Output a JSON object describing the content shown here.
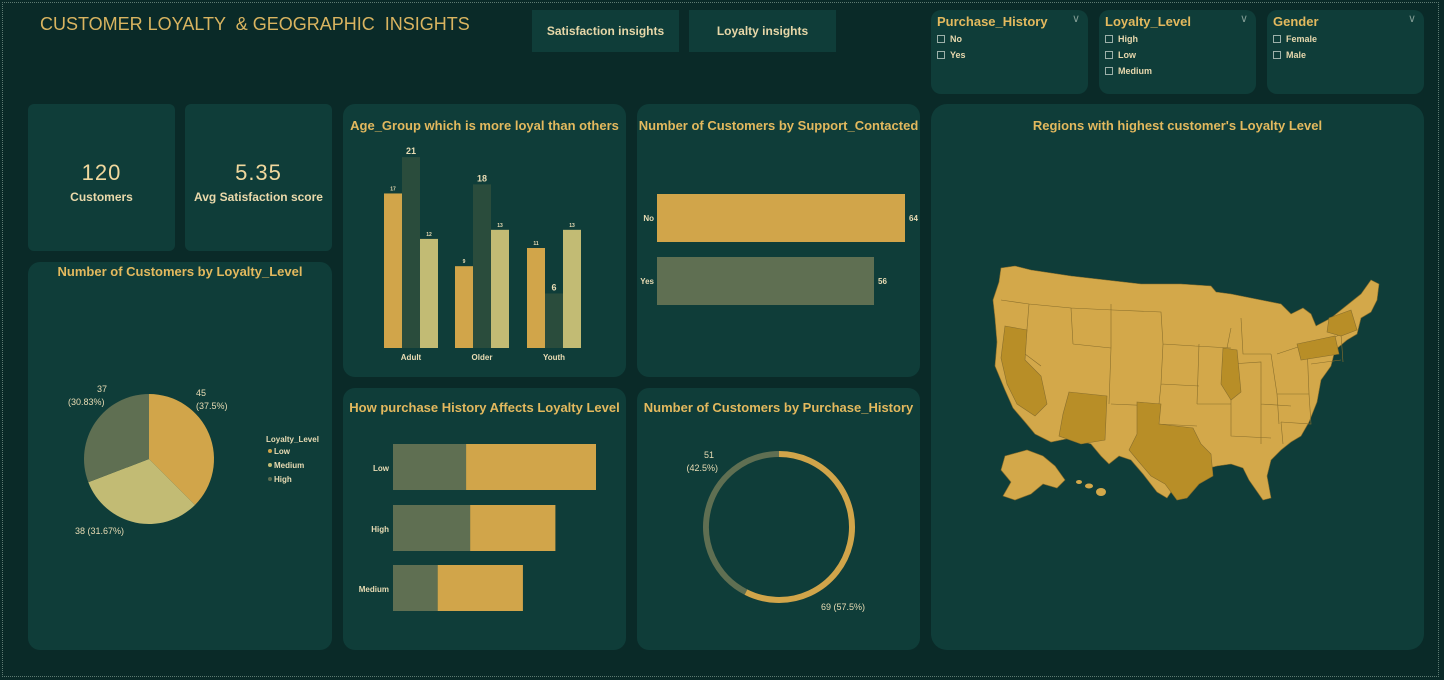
{
  "header": {
    "title": "CUSTOMER LOYALTY  & GEOGRAPHIC  INSIGHTS",
    "nav": [
      "Satisfaction insights",
      "Loyalty insights"
    ]
  },
  "slicers": [
    {
      "title": "Purchase_History",
      "options": [
        "No",
        "Yes"
      ]
    },
    {
      "title": "Loyalty_Level",
      "options": [
        "High",
        "Low",
        "Medium"
      ]
    },
    {
      "title": "Gender",
      "options": [
        "Female",
        "Male"
      ]
    }
  ],
  "kpis": [
    {
      "value": "120",
      "label": "Customers"
    },
    {
      "value": "5.35",
      "label": "Avg Satisfaction score"
    }
  ],
  "colors": {
    "background": "#0a2a28",
    "card": "#0f3d39",
    "accent_gold": "#d1a54a",
    "olive": "#5f6f52",
    "light_olive": "#c2bb74",
    "dark_green": "#2a4c3c",
    "map_fill": "#d3a84a",
    "map_highlight": "#b88e27"
  },
  "titles": {
    "age_group": "Age_Group which is more loyal than others",
    "support": "Number of Customers by Support_Contacted",
    "loyalty_pie": "Number of Customers by Loyalty_Level",
    "purchase_loyalty": "How purchase History Affects Loyalty Level",
    "purchase_donut": "Number of Customers by Purchase_History",
    "map": "Regions with highest customer's Loyalty Level"
  },
  "chart_data": [
    {
      "id": "age_group",
      "type": "bar",
      "categories": [
        "Adult",
        "Older",
        "Youth"
      ],
      "series": [
        {
          "color": "#d1a54a",
          "values": [
            17,
            9,
            11
          ]
        },
        {
          "color": "#2a4c3c",
          "values": [
            21,
            18,
            6
          ]
        },
        {
          "color": "#c2bb74",
          "values": [
            12,
            13,
            13
          ]
        }
      ],
      "ylim": [
        0,
        22
      ]
    },
    {
      "id": "support",
      "type": "bar",
      "orientation": "horizontal",
      "categories": [
        "No",
        "Yes"
      ],
      "values": [
        64,
        56
      ],
      "colors": [
        "#d1a54a",
        "#5f6f52"
      ]
    },
    {
      "id": "loyalty_pie",
      "type": "pie",
      "legend_title": "Loyalty_Level",
      "legend": [
        "Low",
        "Medium",
        "High"
      ],
      "slices": [
        {
          "label": "Low",
          "value": 45,
          "pct": "(37.5%)",
          "color": "#d1a54a"
        },
        {
          "label": "Medium",
          "value": 38,
          "pct": "(31.67%)",
          "color": "#c2bb74"
        },
        {
          "label": "High",
          "value": 37,
          "pct": "(30.83%)",
          "color": "#5f6f52"
        }
      ],
      "data_labels": [
        "45",
        "(37.5%)",
        "38 (31.67%)",
        "37",
        "(30.83%)"
      ]
    },
    {
      "id": "purchase_loyalty",
      "type": "bar",
      "orientation": "horizontal",
      "stacked": true,
      "categories": [
        "Low",
        "High",
        "Medium"
      ],
      "series": [
        {
          "color": "#5f6f52",
          "values": [
            18,
            19,
            11
          ]
        },
        {
          "color": "#d1a54a",
          "values": [
            32,
            21,
            21
          ]
        }
      ]
    },
    {
      "id": "purchase_donut",
      "type": "pie",
      "style": "donut",
      "slices": [
        {
          "value": 69,
          "pct": "(57.5%)",
          "color": "#d1a54a"
        },
        {
          "value": 51,
          "pct": "(42.5%)",
          "color": "#5f6f52"
        }
      ],
      "data_labels": [
        "51",
        "(42.5%)",
        "69 (57.5%)"
      ]
    }
  ]
}
